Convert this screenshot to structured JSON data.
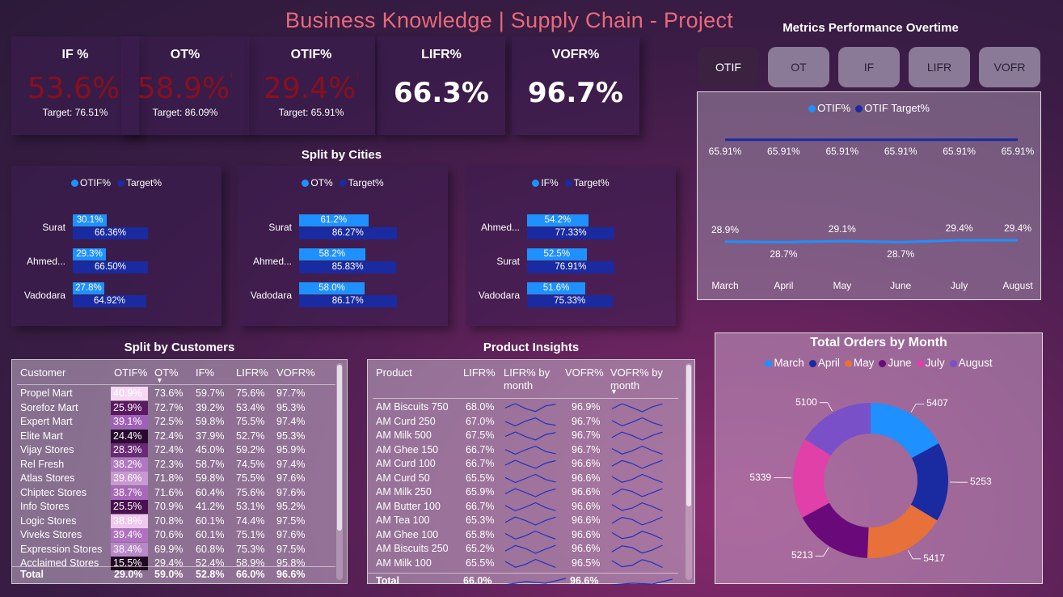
{
  "title": "Business Knowledge | Supply Chain - Project",
  "kpis": [
    {
      "label": "IF %",
      "value": "53.6%",
      "target": "Target: 76.51%",
      "status": "bad"
    },
    {
      "label": "OT%",
      "value": "58.9%",
      "target": "Target: 86.09%",
      "status": "bad"
    },
    {
      "label": "OTIF%",
      "value": "29.4%",
      "target": "Target: 65.91%",
      "status": "bad"
    },
    {
      "label": "LIFR%",
      "value": "66.3%",
      "target": "",
      "status": "good"
    },
    {
      "label": "VOFR%",
      "value": "96.7%",
      "target": "",
      "status": "good"
    }
  ],
  "colors": {
    "actual": "#1e90ff",
    "target": "#1a2aa0",
    "bad": "#8a0f1e",
    "title": "#e86a7a"
  },
  "cities": {
    "title": "Split by Cities",
    "panels": [
      {
        "legend": [
          "OTIF%",
          "Target%"
        ],
        "rows": [
          {
            "name": "Surat",
            "actual": 30.1,
            "actual_label": "30.1%",
            "target": 66.36,
            "target_label": "66.36%"
          },
          {
            "name": "Ahmed...",
            "actual": 29.3,
            "actual_label": "29.3%",
            "target": 66.5,
            "target_label": "66.50%"
          },
          {
            "name": "Vadodara",
            "actual": 27.8,
            "actual_label": "27.8%",
            "target": 64.92,
            "target_label": "64.92%"
          }
        ]
      },
      {
        "legend": [
          "OT%",
          "Target%"
        ],
        "rows": [
          {
            "name": "Surat",
            "actual": 61.2,
            "actual_label": "61.2%",
            "target": 86.27,
            "target_label": "86.27%"
          },
          {
            "name": "Ahmed...",
            "actual": 58.2,
            "actual_label": "58.2%",
            "target": 85.83,
            "target_label": "85.83%"
          },
          {
            "name": "Vadodara",
            "actual": 58.0,
            "actual_label": "58.0%",
            "target": 86.17,
            "target_label": "86.17%"
          }
        ]
      },
      {
        "legend": [
          "IF%",
          "Target%"
        ],
        "rows": [
          {
            "name": "Ahmed...",
            "actual": 54.2,
            "actual_label": "54.2%",
            "target": 77.33,
            "target_label": "77.33%"
          },
          {
            "name": "Surat",
            "actual": 52.5,
            "actual_label": "52.5%",
            "target": 76.91,
            "target_label": "76.91%"
          },
          {
            "name": "Vadodara",
            "actual": 51.6,
            "actual_label": "51.6%",
            "target": 75.33,
            "target_label": "75.33%"
          }
        ]
      }
    ]
  },
  "metrics": {
    "title": "Metrics Performance Overtime",
    "tabs": [
      "OTIF",
      "OT",
      "IF",
      "LIFR",
      "VOFR"
    ],
    "active_tab": "OTIF"
  },
  "chart_data": [
    {
      "type": "line",
      "legend": [
        "OTIF%",
        "OTIF Target%"
      ],
      "categories": [
        "March",
        "April",
        "May",
        "June",
        "July",
        "August"
      ],
      "series": [
        {
          "name": "OTIF%",
          "values": [
            28.9,
            28.7,
            29.1,
            28.7,
            29.4,
            29.4
          ],
          "labels": [
            "28.9%",
            "28.7%",
            "29.1%",
            "28.7%",
            "29.4%",
            "29.4%"
          ]
        },
        {
          "name": "OTIF Target%",
          "values": [
            65.91,
            65.91,
            65.91,
            65.91,
            65.91,
            65.91
          ],
          "labels": [
            "65.91%",
            "65.91%",
            "65.91%",
            "65.91%",
            "65.91%",
            "65.91%"
          ]
        }
      ]
    },
    {
      "type": "pie",
      "title": "Total Orders by Month",
      "categories": [
        "March",
        "April",
        "May",
        "June",
        "July",
        "August"
      ],
      "values": [
        5407,
        5253,
        5417,
        5213,
        5339,
        5100
      ],
      "colors": [
        "#1e90ff",
        "#1a2aa0",
        "#e8703a",
        "#6a0a7a",
        "#e040a8",
        "#7a50c8"
      ]
    }
  ],
  "customers": {
    "title": "Split by Customers",
    "headers": [
      "Customer",
      "OTIF%",
      "OT%",
      "IF%",
      "LIFR%",
      "VOFR%"
    ],
    "rows": [
      [
        "Propel Mart",
        "40.9%",
        "73.6%",
        "59.7%",
        "75.6%",
        "97.7%"
      ],
      [
        "Sorefoz Mart",
        "25.9%",
        "72.7%",
        "39.2%",
        "53.4%",
        "95.3%"
      ],
      [
        "Expert Mart",
        "39.1%",
        "72.5%",
        "59.8%",
        "75.5%",
        "97.4%"
      ],
      [
        "Elite Mart",
        "24.4%",
        "72.4%",
        "37.9%",
        "52.7%",
        "95.3%"
      ],
      [
        "Vijay Stores",
        "28.3%",
        "72.4%",
        "45.0%",
        "59.2%",
        "95.9%"
      ],
      [
        "Rel Fresh",
        "38.2%",
        "72.3%",
        "58.7%",
        "74.5%",
        "97.4%"
      ],
      [
        "Atlas Stores",
        "39.6%",
        "71.8%",
        "59.8%",
        "75.5%",
        "97.6%"
      ],
      [
        "Chiptec Stores",
        "38.7%",
        "71.6%",
        "60.4%",
        "75.6%",
        "97.6%"
      ],
      [
        "Info Stores",
        "25.5%",
        "70.9%",
        "41.2%",
        "53.1%",
        "95.2%"
      ],
      [
        "Logic Stores",
        "38.8%",
        "70.8%",
        "60.1%",
        "74.4%",
        "97.5%"
      ],
      [
        "Viveks Stores",
        "39.4%",
        "70.6%",
        "60.1%",
        "75.1%",
        "97.6%"
      ],
      [
        "Expression Stores",
        "38.4%",
        "69.9%",
        "60.8%",
        "75.3%",
        "97.5%"
      ],
      [
        "Acclaimed Stores",
        "15.5%",
        "29.4%",
        "52.4%",
        "58.9%",
        "95.8%"
      ]
    ],
    "otif_colors": [
      "#f6d8f4",
      "#5a1a60",
      "#a060b8",
      "#2a0a30",
      "#6a2a78",
      "#b078c0",
      "#c898d0",
      "#a868b8",
      "#4a1050",
      "#f0c8ee",
      "#b070c0",
      "#b888c8",
      "#200820"
    ],
    "total": [
      "Total",
      "29.0%",
      "59.0%",
      "52.8%",
      "66.0%",
      "96.6%"
    ]
  },
  "products": {
    "title": "Product Insights",
    "headers": [
      "Product",
      "LIFR%",
      "LIFR% by month",
      "VOFR%",
      "VOFR% by month"
    ],
    "rows": [
      [
        "AM Biscuits 750",
        "68.0%",
        "96.9%"
      ],
      [
        "AM Curd 250",
        "67.0%",
        "96.7%"
      ],
      [
        "AM Milk 500",
        "67.5%",
        "96.7%"
      ],
      [
        "AM Ghee 150",
        "66.7%",
        "96.7%"
      ],
      [
        "AM Curd 100",
        "66.7%",
        "96.6%"
      ],
      [
        "AM Curd 50",
        "65.5%",
        "96.6%"
      ],
      [
        "AM Milk 250",
        "65.9%",
        "96.6%"
      ],
      [
        "AM Butter 100",
        "66.7%",
        "96.6%"
      ],
      [
        "AM Tea 100",
        "65.3%",
        "96.6%"
      ],
      [
        "AM Ghee 100",
        "65.8%",
        "96.6%"
      ],
      [
        "AM Biscuits 250",
        "65.2%",
        "96.6%"
      ],
      [
        "AM Milk 100",
        "65.5%",
        "96.5%"
      ]
    ],
    "total": [
      "Total",
      "66.0%",
      "96.6%"
    ]
  }
}
